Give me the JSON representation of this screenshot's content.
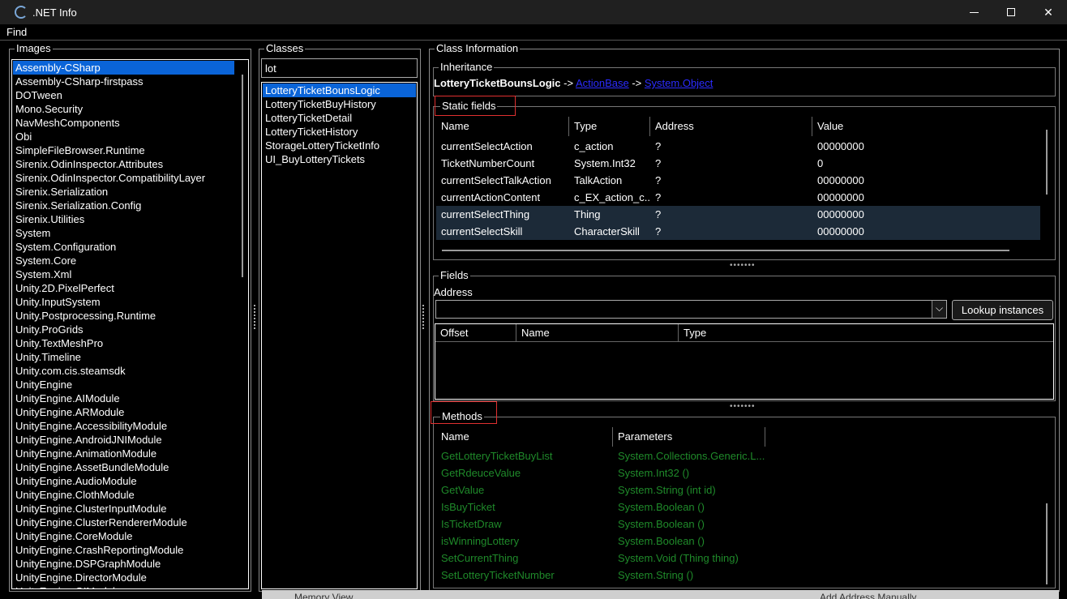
{
  "window": {
    "title": ".NET Info",
    "min_symbol": "",
    "max_symbol": "",
    "close_symbol": "✕"
  },
  "menu": {
    "find": "Find"
  },
  "images": {
    "title": "Images",
    "items": [
      "Assembly-CSharp",
      "Assembly-CSharp-firstpass",
      "DOTween",
      "Mono.Security",
      "NavMeshComponents",
      "Obi",
      "SimpleFileBrowser.Runtime",
      "Sirenix.OdinInspector.Attributes",
      "Sirenix.OdinInspector.CompatibilityLayer",
      "Sirenix.Serialization",
      "Sirenix.Serialization.Config",
      "Sirenix.Utilities",
      "System",
      "System.Configuration",
      "System.Core",
      "System.Xml",
      "Unity.2D.PixelPerfect",
      "Unity.InputSystem",
      "Unity.Postprocessing.Runtime",
      "Unity.ProGrids",
      "Unity.TextMeshPro",
      "Unity.Timeline",
      "Unity.com.cis.steamsdk",
      "UnityEngine",
      "UnityEngine.AIModule",
      "UnityEngine.ARModule",
      "UnityEngine.AccessibilityModule",
      "UnityEngine.AndroidJNIModule",
      "UnityEngine.AnimationModule",
      "UnityEngine.AssetBundleModule",
      "UnityEngine.AudioModule",
      "UnityEngine.ClothModule",
      "UnityEngine.ClusterInputModule",
      "UnityEngine.ClusterRendererModule",
      "UnityEngine.CoreModule",
      "UnityEngine.CrashReportingModule",
      "UnityEngine.DSPGraphModule",
      "UnityEngine.DirectorModule",
      "UnityEngine.GIModule"
    ],
    "selected": 0
  },
  "classes": {
    "title": "Classes",
    "filter": "lot",
    "items": [
      "LotteryTicketBounsLogic",
      "LotteryTicketBuyHistory",
      "LotteryTicketDetail",
      "LotteryTicketHistory",
      "StorageLotteryTicketInfo",
      "UI_BuyLotteryTickets"
    ],
    "selected": 0
  },
  "class_info": {
    "title": "Class Information",
    "inheritance": {
      "title": "Inheritance",
      "class_name": "LotteryTicketBounsLogic",
      "arrow1": " -> ",
      "parent": "ActionBase",
      "arrow2": " -> ",
      "root": "System.Object"
    },
    "static_fields": {
      "title": "Static fields",
      "headers": [
        "Name",
        "Type",
        "Address",
        "Value"
      ],
      "rows": [
        {
          "name": "currentSelectAction",
          "type": "c_action",
          "address": "?",
          "value": "00000000"
        },
        {
          "name": "TicketNumberCount",
          "type": "System.Int32",
          "address": "?",
          "value": "0"
        },
        {
          "name": "currentSelectTalkAction",
          "type": "TalkAction",
          "address": "?",
          "value": "00000000"
        },
        {
          "name": "currentActionContent",
          "type": "c_EX_action_c...",
          "address": "?",
          "value": "00000000"
        },
        {
          "name": "currentSelectThing",
          "type": "Thing",
          "address": "?",
          "value": "00000000"
        },
        {
          "name": "currentSelectSkill",
          "type": "CharacterSkill",
          "address": "?",
          "value": "00000000"
        }
      ]
    },
    "fields": {
      "title": "Fields",
      "address_label": "Address",
      "address_value": "",
      "lookup_button": "Lookup instances",
      "dropdown_icon": "⌵",
      "headers": [
        "Offset",
        "Name",
        "Type"
      ]
    },
    "methods": {
      "title": "Methods",
      "headers": [
        "Name",
        "Parameters"
      ],
      "rows": [
        {
          "name": "GetLotteryTicketBuyList",
          "params": "System.Collections.Generic.L..."
        },
        {
          "name": "GetRdeuceValue",
          "params": "System.Int32 ()"
        },
        {
          "name": "GetValue",
          "params": "System.String (int id)"
        },
        {
          "name": "IsBuyTicket",
          "params": "System.Boolean ()"
        },
        {
          "name": "IsTicketDraw",
          "params": "System.Boolean ()"
        },
        {
          "name": "isWinningLottery",
          "params": "System.Boolean ()"
        },
        {
          "name": "SetCurrentThing",
          "params": "System.Void (Thing thing)"
        },
        {
          "name": "SetLotteryTicketNumber",
          "params": "System.String ()"
        }
      ]
    }
  },
  "background": {
    "memory_view": "Memory View",
    "add_address": "Add Address Manually"
  },
  "splitter": "•••••••",
  "colors": {
    "selection": "#0a64d8",
    "method_green": "#1f8a2a",
    "link": "#2b2bff",
    "highlight_box": "#e03030"
  }
}
